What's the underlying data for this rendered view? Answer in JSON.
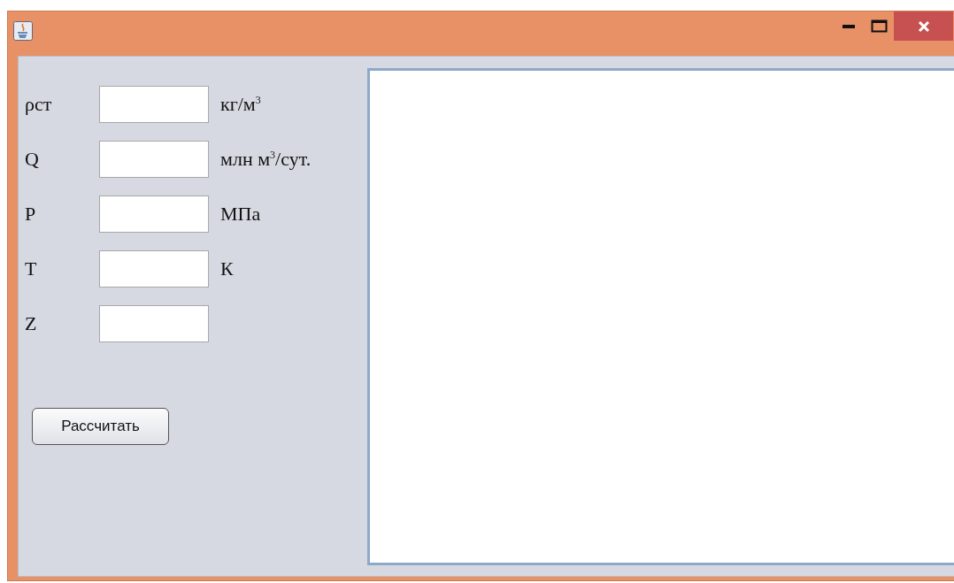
{
  "window": {
    "controls": [
      {
        "kind": "minimize"
      },
      {
        "kind": "maximize"
      },
      {
        "kind": "close"
      }
    ]
  },
  "fields": [
    {
      "label": "ρст",
      "unit": "кг/м$^{3}$"
    },
    {
      "label": "Q",
      "unit": "млн м$^{3}$/сут."
    },
    {
      "label": "P",
      "unit": "МПа"
    },
    {
      "label": "T",
      "unit": "К"
    },
    {
      "label": "Z"
    }
  ],
  "button": "Рассчитать",
  "output": {
    "kind": "text-area"
  }
}
